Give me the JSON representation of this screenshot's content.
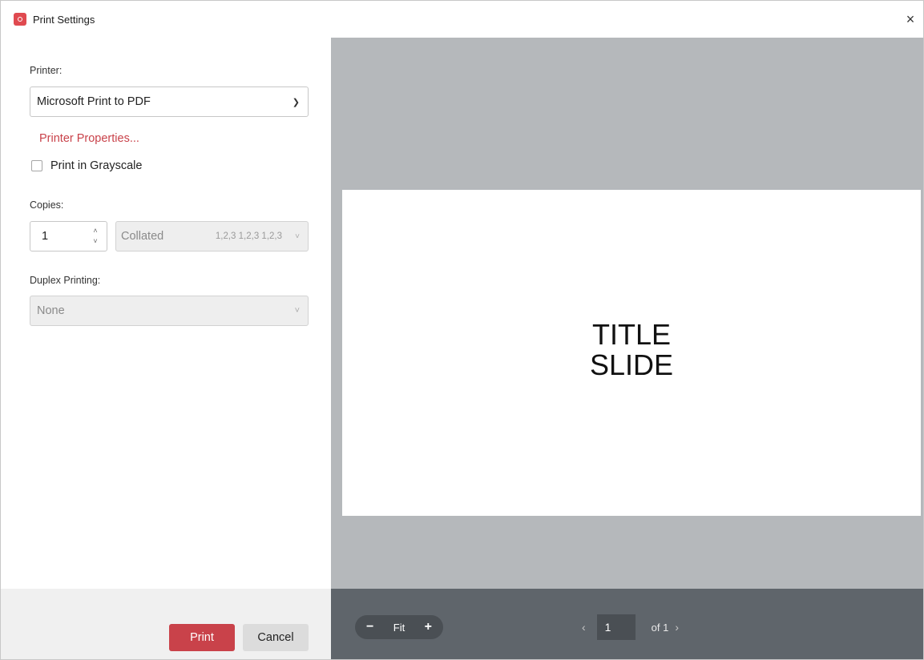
{
  "window": {
    "title": "Print Settings",
    "close_glyph": "×"
  },
  "printer": {
    "label": "Printer:",
    "selected": "Microsoft Print to PDF",
    "properties_link": "Printer Properties..."
  },
  "grayscale": {
    "label": "Print in Grayscale",
    "checked": false
  },
  "copies": {
    "label": "Copies:",
    "value": "1",
    "collate_value": "Collated",
    "collate_order": "1,2,3 1,2,3 1,2,3"
  },
  "duplex": {
    "label": "Duplex Printing:",
    "selected": "None"
  },
  "buttons": {
    "print": "Print",
    "cancel": "Cancel"
  },
  "preview": {
    "slide_title": "TITLE\nSLIDE"
  },
  "zoom": {
    "minus": "−",
    "label": "Fit",
    "plus": "+"
  },
  "pager": {
    "current_page": "1",
    "of_text": "of 1"
  },
  "colors": {
    "accent": "#c9424a",
    "preview_bg": "#b5b8bb",
    "toolbar_bg": "#5f656b"
  }
}
